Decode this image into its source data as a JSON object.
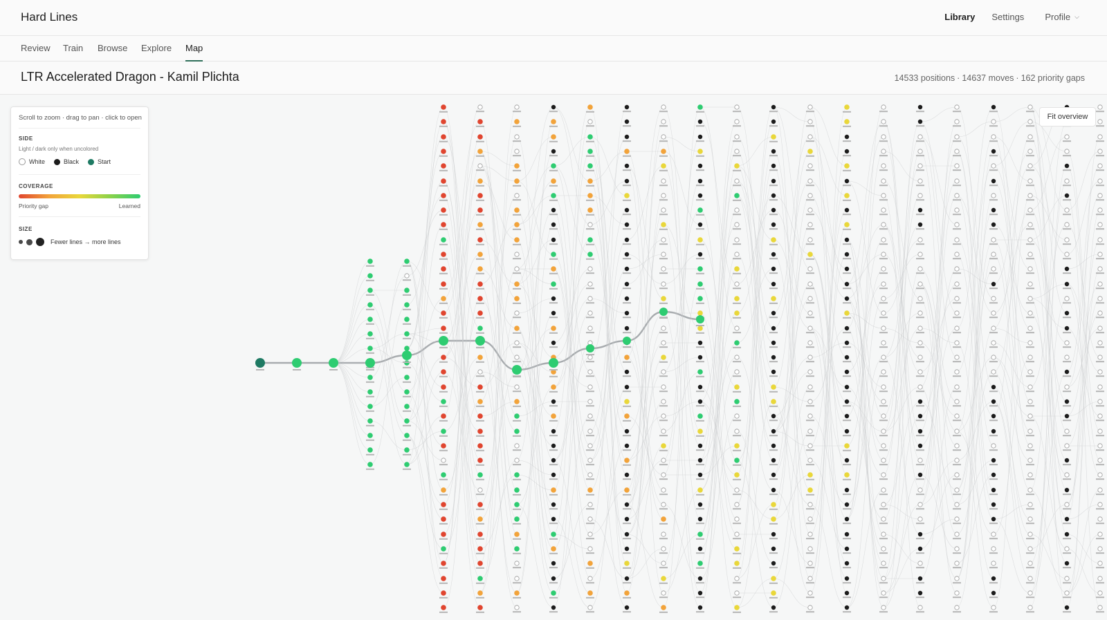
{
  "app": {
    "brand": "Hard Lines"
  },
  "topnav": {
    "library": "Library",
    "settings": "Settings",
    "profile": "Profile"
  },
  "tabs": [
    "Review",
    "Train",
    "Browse",
    "Explore",
    "Map"
  ],
  "active_tab": "Map",
  "page": {
    "title": "LTR Accelerated Dragon - Kamil Plichta",
    "stats": {
      "positions": "14533 positions",
      "moves": "14637 moves",
      "gaps": "162 priority gaps",
      "separator": "·"
    }
  },
  "legend": {
    "hint": "Scroll to zoom · drag to pan · click to open",
    "side_title": "SIDE",
    "side_sub": "Light / dark only when uncolored",
    "side_items": [
      "White",
      "Black",
      "Start"
    ],
    "coverage_title": "COVERAGE",
    "coverage_low": "Priority gap",
    "coverage_high": "Learned",
    "size_title": "SIZE",
    "size_text": "Fewer lines → more lines"
  },
  "map": {
    "fit_label": "Fit overview"
  },
  "colors": {
    "accent": "#2f6f5a",
    "start": "#1e7a63",
    "learned": "#2ecc71",
    "gap": "#e0452f",
    "partial": "#f2a33a",
    "mid": "#e9d73a",
    "black_node": "#1c1c1c",
    "white_node": "#ffffff",
    "edge": "#c7c9cb"
  }
}
